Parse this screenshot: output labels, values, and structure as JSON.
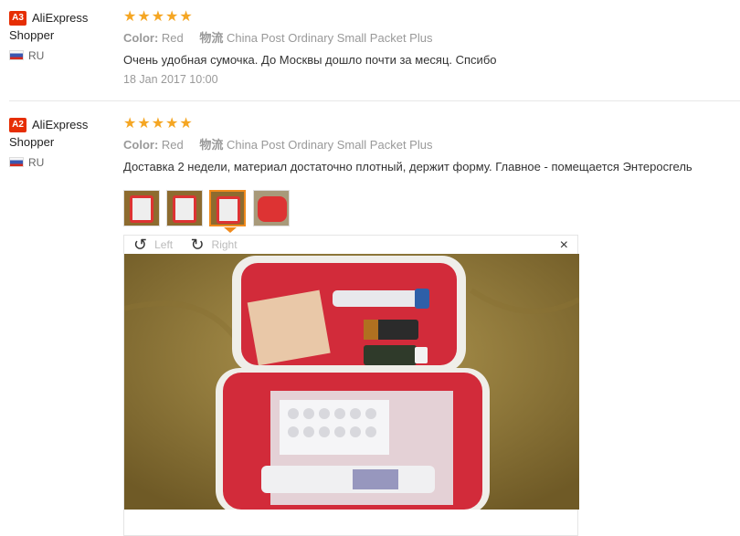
{
  "reviews": [
    {
      "badge": "A3",
      "name_first": "AliExpress",
      "name_second": "Shopper",
      "country": "RU",
      "stars": "★★★★★",
      "color_label": "Color:",
      "color_value": "Red",
      "ship_label": "物流",
      "ship_value": "China Post Ordinary Small Packet Plus",
      "text": "Очень удобная сумочка. До Москвы дошло почти за месяц. Спсибо",
      "date": "18 Jan 2017 10:00"
    },
    {
      "badge": "A2",
      "name_first": "AliExpress",
      "name_second": "Shopper",
      "country": "RU",
      "stars": "★★★★★",
      "color_label": "Color:",
      "color_value": "Red",
      "ship_label": "物流",
      "ship_value": "China Post Ordinary Small Packet Plus",
      "text": "Доставка 2 недели, материал достаточно плотный, держит форму. Главное - помещается Энтеросгель",
      "thumbnails_count": 4,
      "active_thumbnail": 3
    }
  ],
  "viewer": {
    "left_label": "Left",
    "right_label": "Right",
    "close": "×",
    "rotate_left_icon": "↺",
    "rotate_right_icon": "↻"
  },
  "colors": {
    "badge": "#e62e04",
    "star": "#f5a623",
    "active_border": "#f08a1c"
  }
}
